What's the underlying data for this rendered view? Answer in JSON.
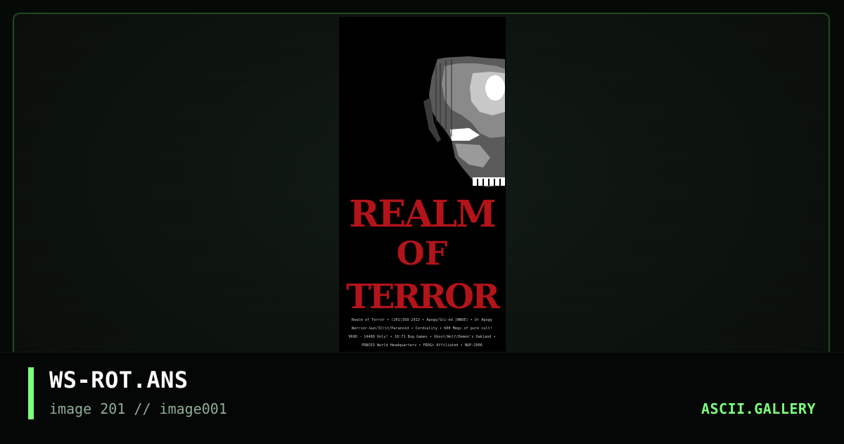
{
  "artwork": {
    "title_letters": [
      "REALM",
      "OF",
      "TERROR"
    ],
    "info_lines": [
      "Realm of Terror • (201)358-2913 • Apogy/Sci-ed (NNOE) • Or Apogy",
      "Warrior-Gun/ICrit/Paranoid • Cordiality • 600 Megs of pure cult!",
      "9600 - 14400 Only! • 10:71 Bug Games • Ghost/Wolf/Demon's Oakland •",
      "FRNCE3 World Headquarters • FROG+ Affiliated • NUP:2006"
    ]
  },
  "caption": {
    "title": "WS-ROT.ANS",
    "subtitle": "image 201 // image001",
    "brand": "ASCII.GALLERY"
  },
  "colors": {
    "accent": "#7cff7c",
    "frame_border": "#1f4a22",
    "blood_red": "#b3141a"
  }
}
